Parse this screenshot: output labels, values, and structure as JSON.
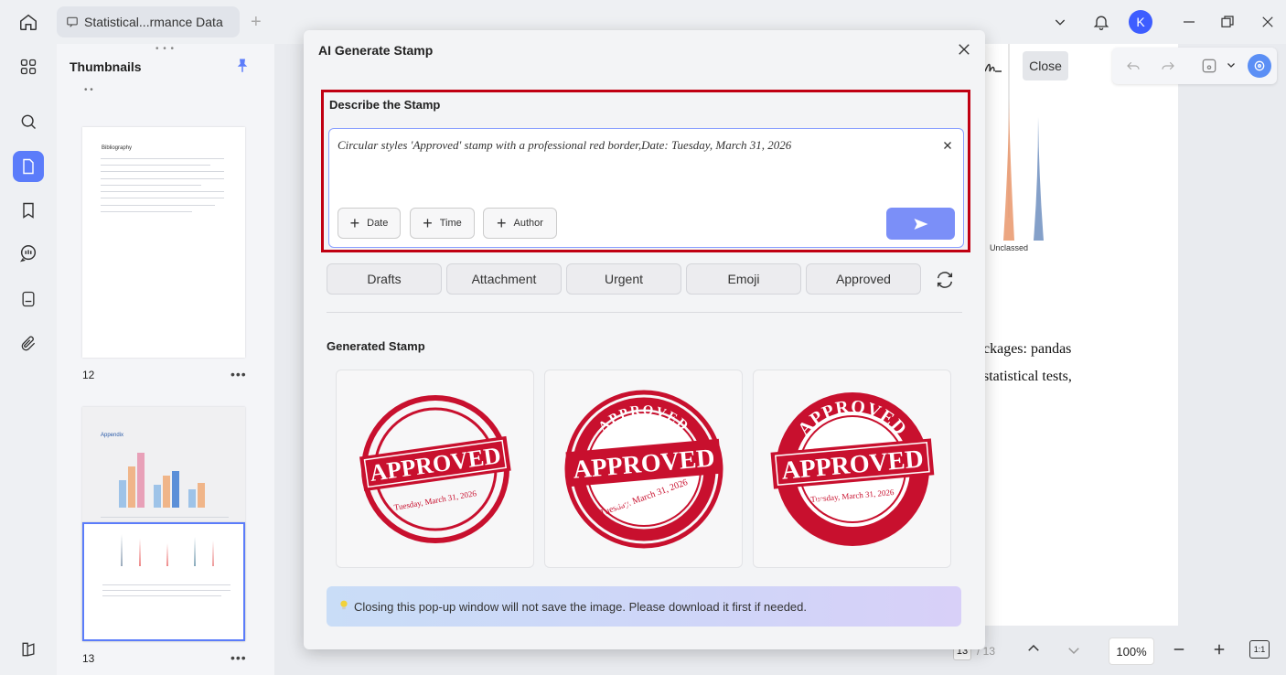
{
  "tab": {
    "title": "Statistical...rmance Data"
  },
  "user": {
    "initial": "K"
  },
  "thumbnails": {
    "title": "Thumbnails",
    "pages": [
      {
        "num": "12",
        "heading": "Bibliography"
      },
      {
        "num": "13",
        "heading": "Appendix"
      }
    ]
  },
  "modal": {
    "title": "AI Generate Stamp",
    "describe_label": "Describe the Stamp",
    "prompt_text": "Circular styles  'Approved' stamp with a professional red border,Date: Tuesday, March 31, 2026",
    "chips": [
      "Date",
      "Time",
      "Author"
    ],
    "quick_options": [
      "Drafts",
      "Attachment",
      "Urgent",
      "Emoji",
      "Approved"
    ],
    "generated_label": "Generated Stamp",
    "stamp_word": "APPROVED",
    "stamp_date": "Tuesday, March 31, 2026",
    "notice": "Closing this pop-up window will not save the image. Please download it first if needed."
  },
  "document": {
    "close_label": "Close",
    "chart_label": "Unclassed",
    "line1": "ckages: pandas",
    "line2": "statistical tests,",
    "zoom": "100%",
    "page_current": "13",
    "page_total": "/ 13",
    "fit_label": "1:1"
  },
  "colors": {
    "accent": "#5b7cfa",
    "stamp_red": "#c8102e",
    "highlight_border": "#c00012"
  }
}
